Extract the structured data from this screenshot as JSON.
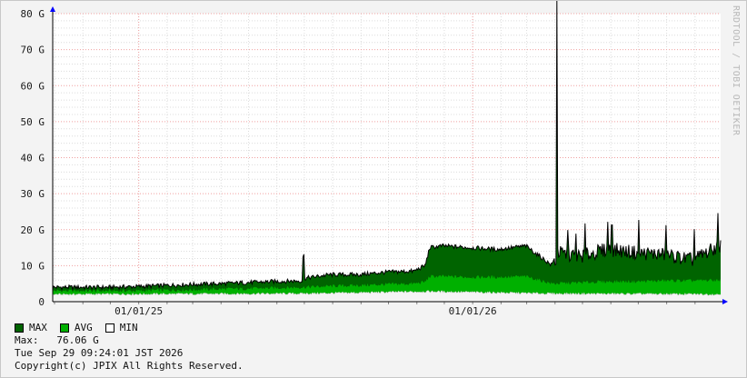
{
  "chart_data": {
    "type": "area",
    "y_ticks": [
      "0",
      "10 G",
      "20 G",
      "30 G",
      "40 G",
      "50 G",
      "60 G",
      "70 G",
      "80 G"
    ],
    "y_tick_values": [
      0,
      10,
      20,
      30,
      40,
      50,
      60,
      70,
      80
    ],
    "ylim": [
      0,
      80
    ],
    "y_unit": "G",
    "x_labels": [
      "01/01/25",
      "01/01/26"
    ],
    "x_label_dates": [
      "2025-01-01",
      "2026-01-01"
    ],
    "xlim": [
      "2024-09-29",
      "2026-09-29"
    ],
    "grid": true,
    "watermark": "RRDTOOL / TOBI OETIKER",
    "series": [
      {
        "name": "MAX",
        "color": "#006400",
        "x": [
          "2024-09-29",
          "2024-10-29",
          "2024-11-29",
          "2024-12-29",
          "2025-01-29",
          "2025-02-28",
          "2025-03-29",
          "2025-04-29",
          "2025-05-29",
          "2025-06-29",
          "2025-06-30",
          "2025-07-01",
          "2025-07-29",
          "2025-08-29",
          "2025-09-29",
          "2025-10-29",
          "2025-11-10",
          "2025-11-15",
          "2025-11-29",
          "2025-12-29",
          "2026-01-29",
          "2026-02-28",
          "2026-03-29",
          "2026-04-02",
          "2026-04-03",
          "2026-04-04",
          "2026-04-29",
          "2026-05-29",
          "2026-06-29",
          "2026-07-29",
          "2026-08-29",
          "2026-09-29"
        ],
        "values": [
          4,
          4,
          4,
          4.2,
          4.5,
          4.8,
          5,
          5.3,
          5.6,
          5.8,
          19,
          6.5,
          7.5,
          7.5,
          8.2,
          8.5,
          10,
          15,
          15.5,
          15,
          14.5,
          15.5,
          10,
          11,
          76,
          13,
          12,
          14,
          13,
          12.5,
          11,
          15
        ]
      },
      {
        "name": "AVG",
        "color": "#00b000",
        "x": [
          "2024-09-29",
          "2024-10-29",
          "2024-11-29",
          "2024-12-29",
          "2025-01-29",
          "2025-02-28",
          "2025-03-29",
          "2025-04-29",
          "2025-05-29",
          "2025-06-29",
          "2025-07-29",
          "2025-08-29",
          "2025-09-29",
          "2025-10-29",
          "2025-11-10",
          "2025-11-15",
          "2025-11-29",
          "2025-12-29",
          "2026-01-29",
          "2026-02-28",
          "2026-03-29",
          "2026-04-29",
          "2026-05-29",
          "2026-06-29",
          "2026-07-29",
          "2026-08-29",
          "2026-09-29"
        ],
        "values": [
          3,
          3,
          3,
          3,
          3.2,
          3.3,
          3.5,
          3.6,
          3.8,
          4,
          4.3,
          4.5,
          4.8,
          5,
          5.5,
          7,
          7,
          6.8,
          6.8,
          7,
          5,
          5.3,
          5.6,
          5.6,
          5.8,
          5.8,
          6
        ]
      },
      {
        "name": "MIN",
        "color": "#ffffff",
        "x": [
          "2024-09-29",
          "2025-06-29",
          "2025-11-15",
          "2026-03-29",
          "2026-09-29"
        ],
        "values": [
          2,
          2.2,
          2.8,
          2.2,
          2
        ]
      }
    ]
  },
  "legend": {
    "items": [
      {
        "label": "MAX",
        "color": "#006400"
      },
      {
        "label": "AVG",
        "color": "#00b000"
      },
      {
        "label": "MIN",
        "color": "#ffffff"
      }
    ],
    "max_line": "Max:   76.06 G",
    "date_line": "Tue Sep 29 09:24:01 JST 2026",
    "copyright_line": "Copyright(c) JPIX All Rights Reserved."
  }
}
